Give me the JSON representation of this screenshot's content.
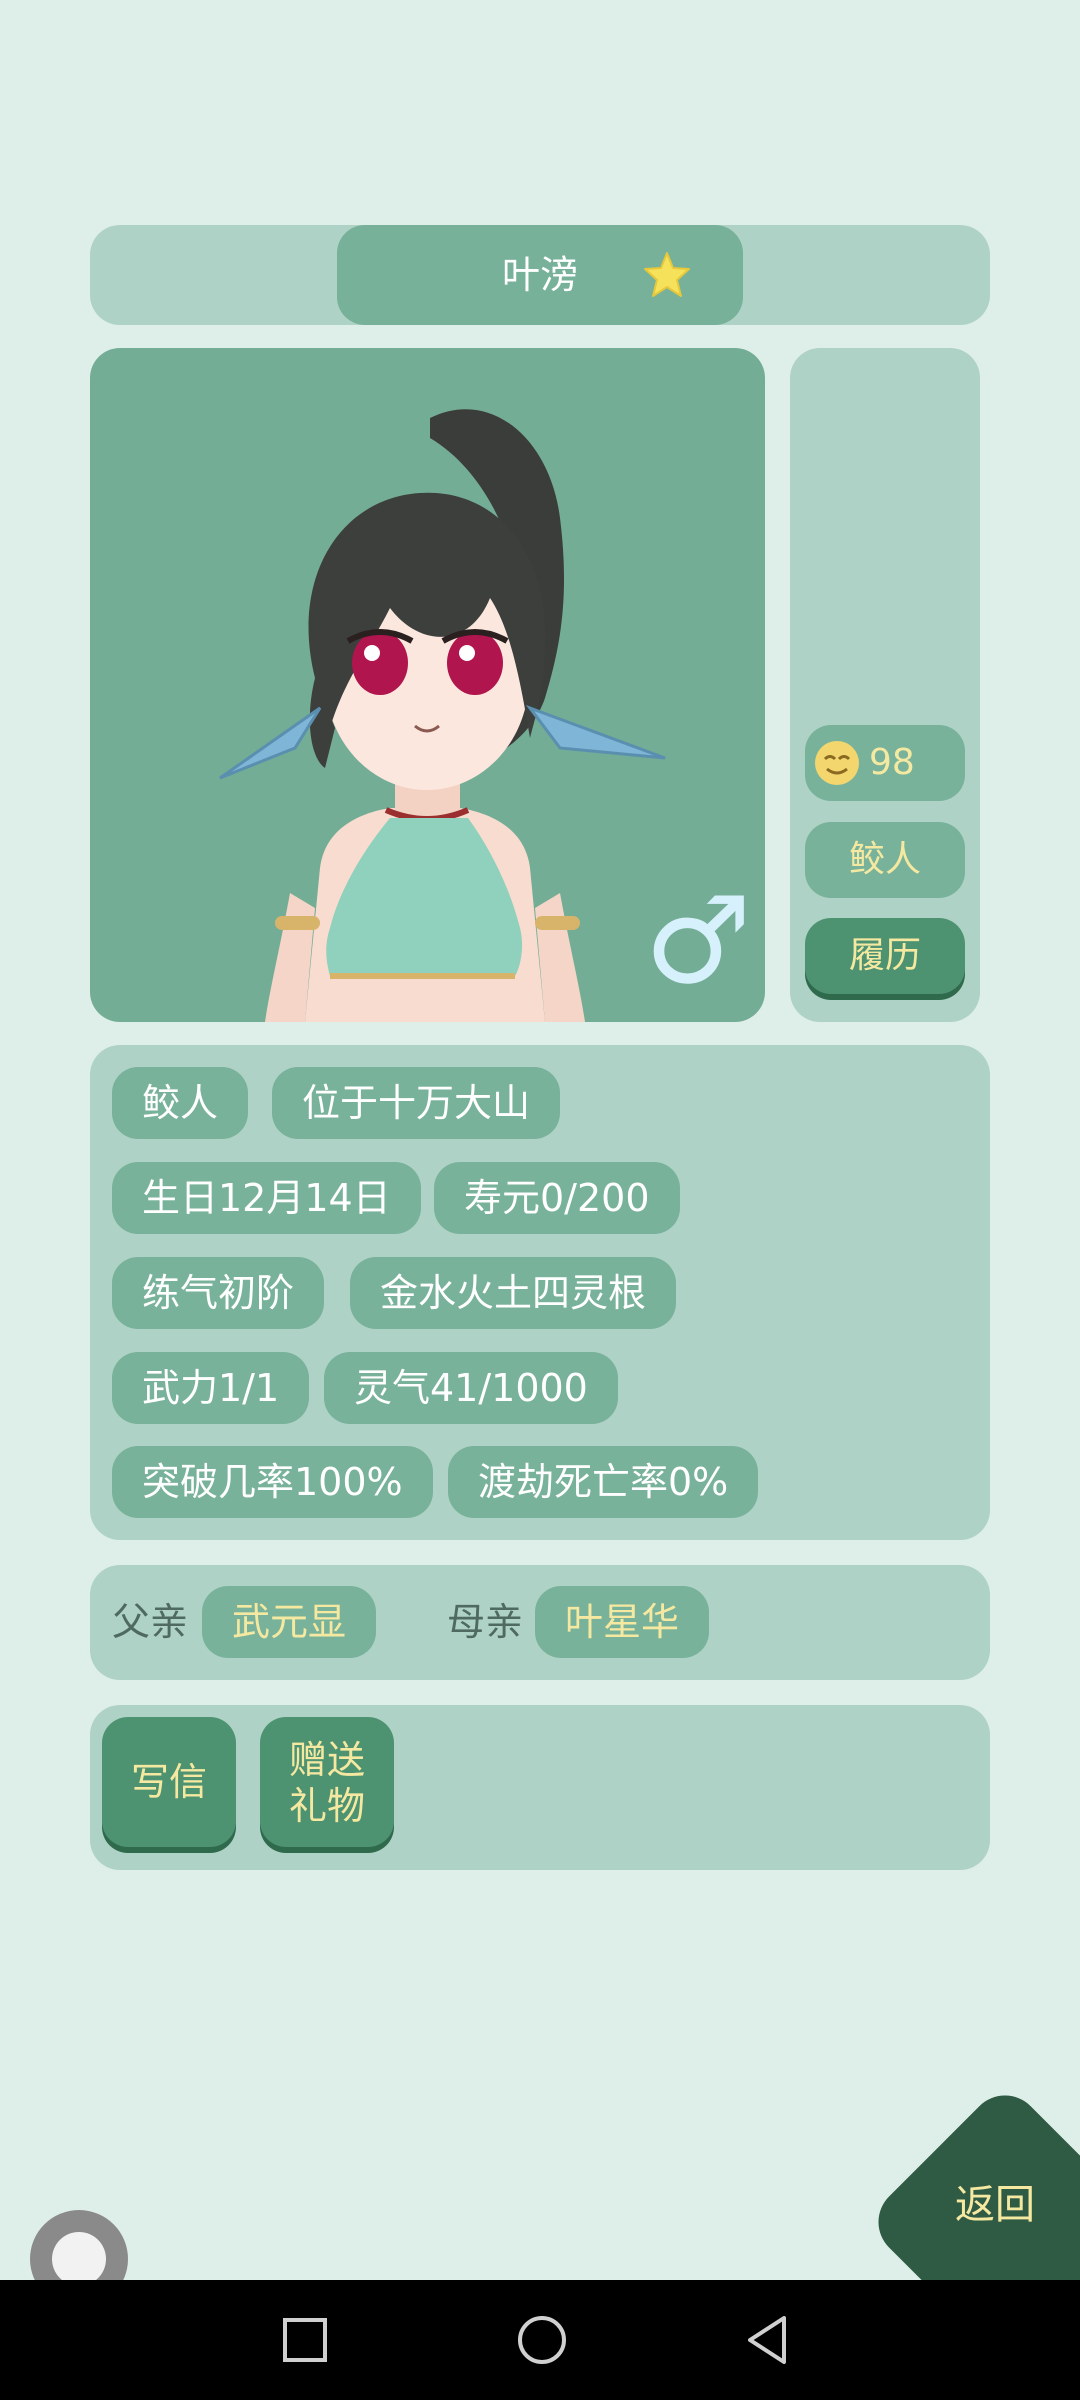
{
  "header": {
    "name": "叶滂"
  },
  "portrait": {
    "gender_symbol": "♂"
  },
  "side": {
    "mood_value": "98",
    "race": "鲛人",
    "resume_button": "履历"
  },
  "tags": [
    [
      "鲛人",
      "位于十万大山"
    ],
    [
      "生日12月14日",
      "寿元0/200"
    ],
    [
      "练气初阶",
      "金水火土四灵根"
    ],
    [
      "武力1/1",
      "灵气41/1000"
    ],
    [
      "突破几率100%",
      "渡劫死亡率0%"
    ]
  ],
  "family": {
    "father_label": "父亲",
    "father_name": "武元显",
    "mother_label": "母亲",
    "mother_name": "叶星华"
  },
  "actions": {
    "write_letter": "写信",
    "gift_line1": "赠送",
    "gift_line2": "礼物"
  },
  "back_button": "返回"
}
